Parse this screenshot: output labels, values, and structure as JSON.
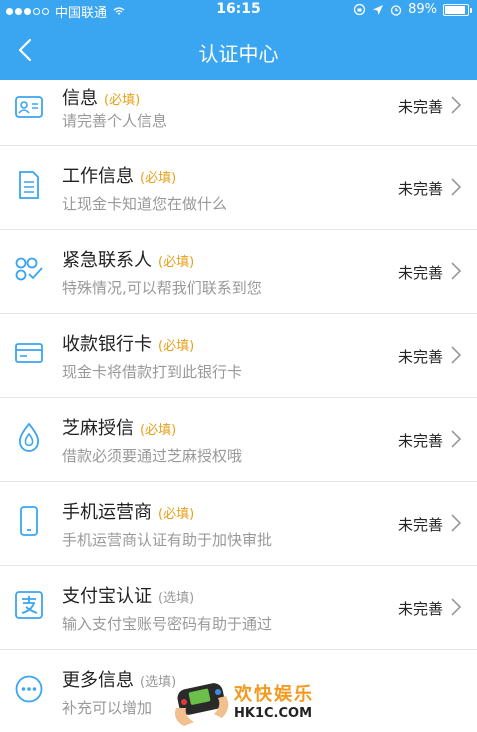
{
  "status_bar": {
    "carrier": "中国联通",
    "time": "16:15",
    "battery": "89%",
    "battery_level": 0.89
  },
  "nav": {
    "title": "认证中心",
    "back_icon": "chevron-left-icon"
  },
  "items": [
    {
      "title": "信息",
      "tag": "(必填)",
      "tag_type": "req",
      "subtitle": "请完善个人信息",
      "status": "未完善",
      "icon": "id-card-icon"
    },
    {
      "title": "工作信息",
      "tag": "(必填)",
      "tag_type": "req",
      "subtitle": "让现金卡知道您在做什么",
      "status": "未完善",
      "icon": "document-icon"
    },
    {
      "title": "紧急联系人",
      "tag": "(必填)",
      "tag_type": "req",
      "subtitle": "特殊情况,可以帮我们联系到您",
      "status": "未完善",
      "icon": "contacts-icon"
    },
    {
      "title": "收款银行卡",
      "tag": "(必填)",
      "tag_type": "req",
      "subtitle": "现金卡将借款打到此银行卡",
      "status": "未完善",
      "icon": "bank-card-icon"
    },
    {
      "title": "芝麻授信",
      "tag": "(必填)",
      "tag_type": "req",
      "subtitle": "借款必须要通过芝麻授权哦",
      "status": "未完善",
      "icon": "sesame-icon"
    },
    {
      "title": "手机运营商",
      "tag": "(必填)",
      "tag_type": "req",
      "subtitle": "手机运营商认证有助于加快审批",
      "status": "未完善",
      "icon": "phone-icon"
    },
    {
      "title": "支付宝认证",
      "tag": "(选填)",
      "tag_type": "opt",
      "subtitle": "输入支付宝账号密码有助于通过",
      "status": "未完善",
      "icon": "alipay-icon"
    },
    {
      "title": "更多信息",
      "tag": "(选填)",
      "tag_type": "opt",
      "subtitle": "补充可以增加",
      "status": "",
      "icon": "more-icon"
    }
  ],
  "watermark": {
    "brand": "欢快娱乐",
    "url": "HK1C.COM"
  },
  "colors": {
    "primary": "#3aa5f0",
    "required": "#e8a019",
    "muted": "#999999"
  }
}
